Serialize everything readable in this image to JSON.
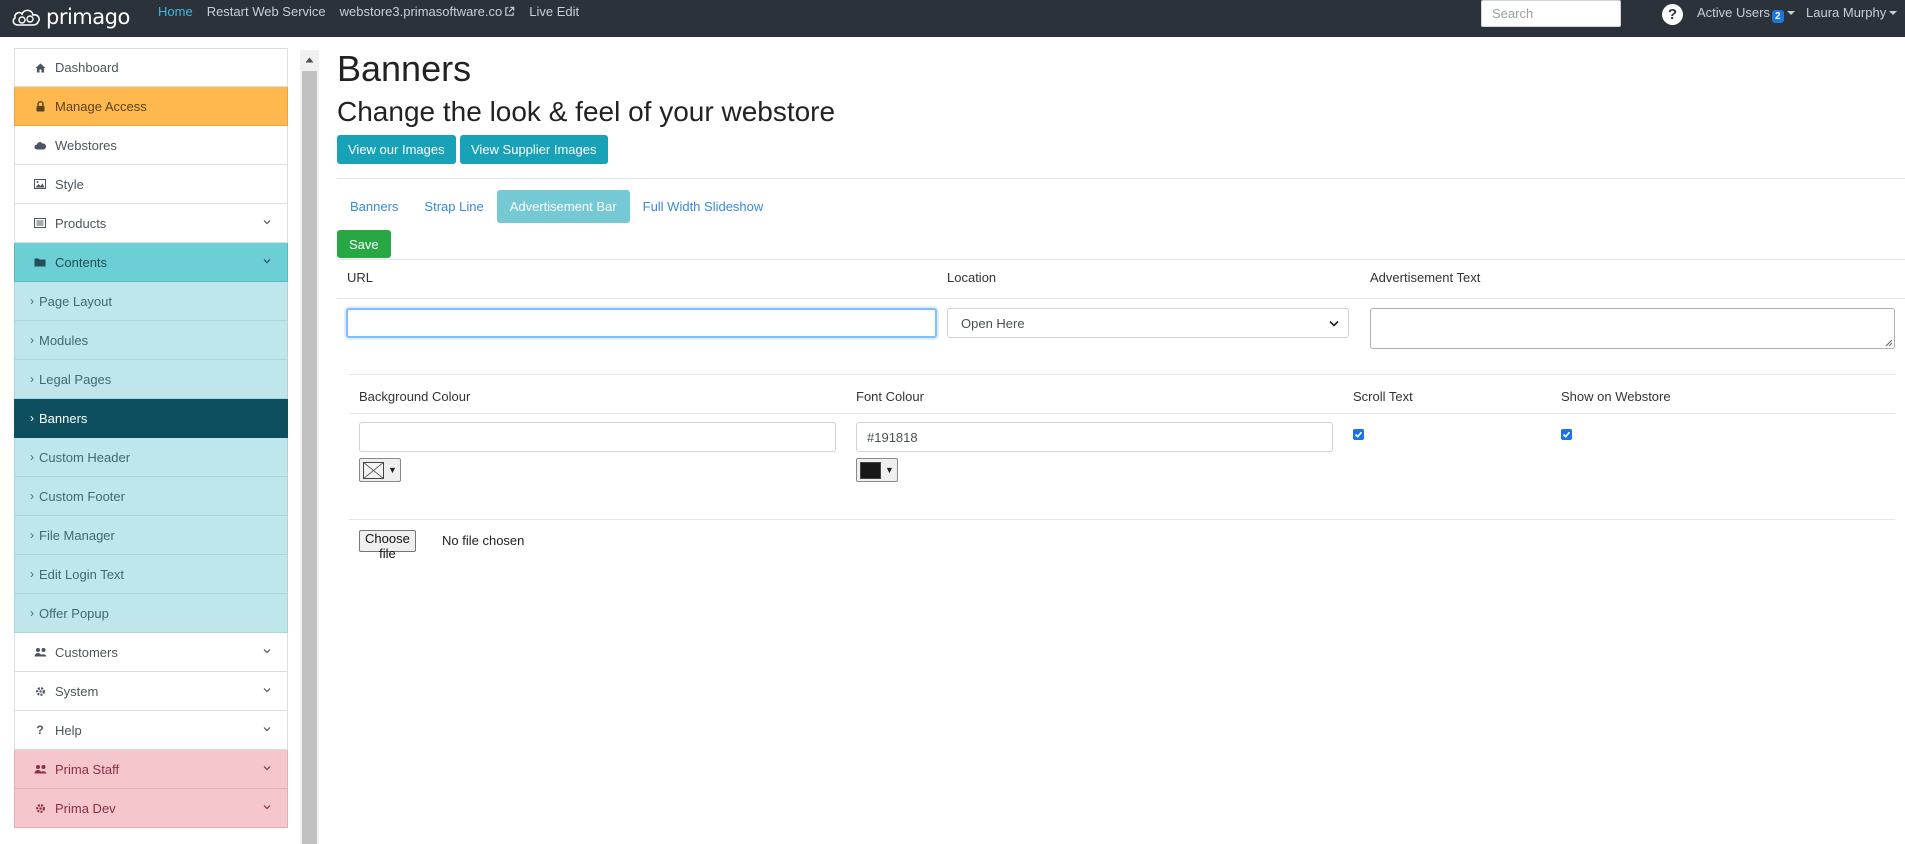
{
  "topbar": {
    "brand": "primago",
    "links": [
      "Home",
      "Restart Web Service",
      "webstore3.primasoftware.co",
      "Live Edit"
    ],
    "search_placeholder": "Search",
    "active_users_label": "Active Users",
    "active_users_count": "2",
    "user_name": "Laura Murphy"
  },
  "sidebar": {
    "items": [
      {
        "label": "Dashboard",
        "icon": "home-icon"
      },
      {
        "label": "Manage Access",
        "icon": "lock-icon"
      },
      {
        "label": "Webstores",
        "icon": "cloud-icon"
      },
      {
        "label": "Style",
        "icon": "image-icon"
      },
      {
        "label": "Products",
        "icon": "list-icon"
      },
      {
        "label": "Contents",
        "icon": "folder-icon"
      },
      {
        "label": "Page Layout"
      },
      {
        "label": "Modules"
      },
      {
        "label": "Legal Pages"
      },
      {
        "label": "Banners"
      },
      {
        "label": "Custom Header"
      },
      {
        "label": "Custom Footer"
      },
      {
        "label": "File Manager"
      },
      {
        "label": "Edit Login Text"
      },
      {
        "label": "Offer Popup"
      },
      {
        "label": "Customers",
        "icon": "users-icon"
      },
      {
        "label": "System",
        "icon": "gear-icon"
      },
      {
        "label": "Help",
        "icon": "question-icon"
      },
      {
        "label": "Prima Staff",
        "icon": "users-icon"
      },
      {
        "label": "Prima Dev",
        "icon": "gear-icon"
      }
    ]
  },
  "page": {
    "title": "Banners",
    "subtitle": "Change the look & feel of your webstore",
    "view_images_button": "View our Images",
    "view_supplier_images_button": "View Supplier Images"
  },
  "tabs": [
    "Banners",
    "Strap Line",
    "Advertisement Bar",
    "Full Width Slideshow"
  ],
  "active_tab": "Advertisement Bar",
  "form": {
    "save_label": "Save",
    "url_header": "URL",
    "url_value": "",
    "location_header": "Location",
    "location_value": "Open Here",
    "ad_text_header": "Advertisement Text",
    "ad_text_value": "",
    "bg_colour_header": "Background Colour",
    "bg_colour_value": "",
    "font_colour_header": "Font Colour",
    "font_colour_value": "#191818",
    "scroll_text_header": "Scroll Text",
    "scroll_text_checked": true,
    "show_on_webstore_header": "Show on Webstore",
    "show_on_webstore_checked": true,
    "file_button_label": "Choose file",
    "file_status": "No file chosen"
  },
  "colors": {
    "topbar_bg": "#2b323a",
    "accent_info": "#17a2b8",
    "save_green": "#28a745",
    "active_tab": "#74c9d4",
    "sidebar_orange": "#ffb84d",
    "sidebar_teal": "#6dcfd6",
    "sidebar_sub": "#bfe6ea",
    "sidebar_selected": "#0e4f5f",
    "sidebar_pink": "#f5c6cc",
    "font_colour_swatch": "#191818"
  }
}
